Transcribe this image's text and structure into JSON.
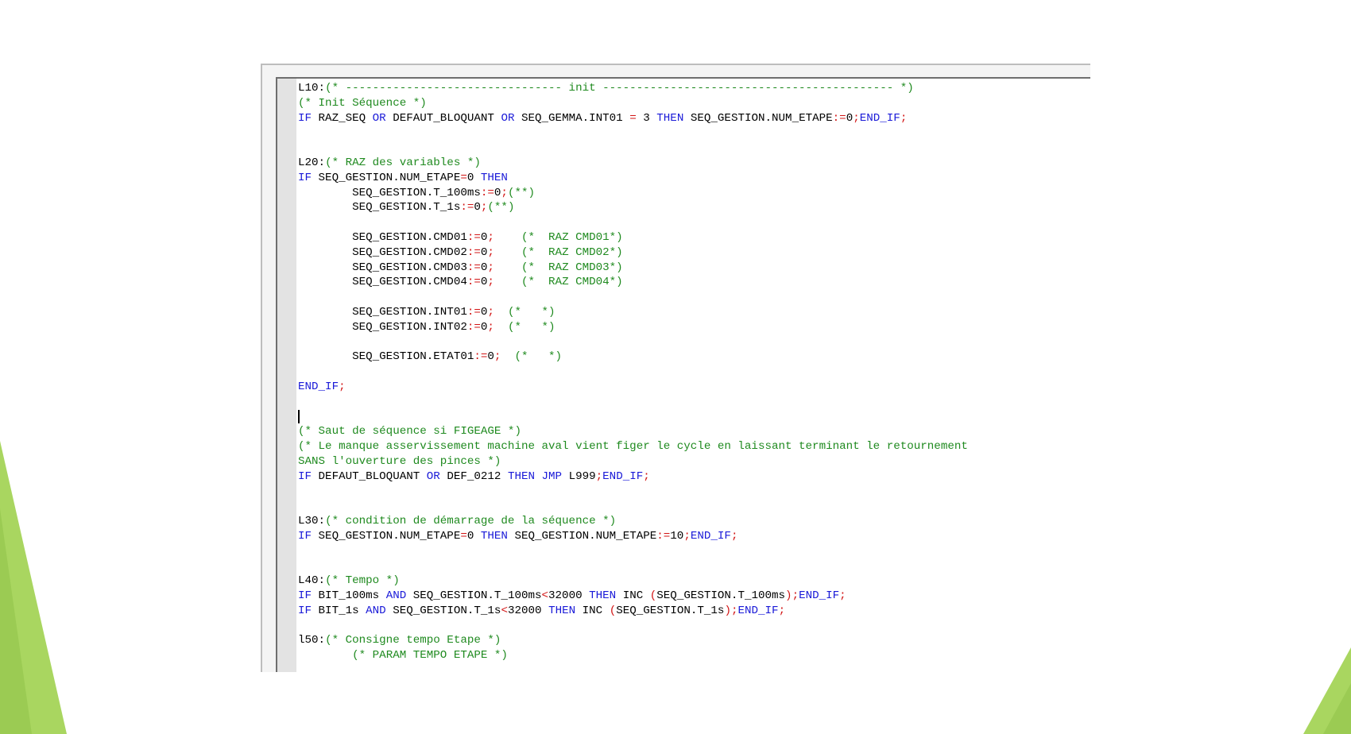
{
  "editor": {
    "lines": [
      [
        {
          "t": "L10:",
          "c": "id"
        },
        {
          "t": "(* -------------------------------- init ------------------------------------------- *)",
          "c": "cm"
        }
      ],
      [
        {
          "t": "(* Init Séquence *)",
          "c": "cm"
        }
      ],
      [
        {
          "t": "IF",
          "c": "kw"
        },
        {
          "t": " RAZ_SEQ ",
          "c": "id"
        },
        {
          "t": "OR",
          "c": "kw"
        },
        {
          "t": " DEFAUT_BLOQUANT ",
          "c": "id"
        },
        {
          "t": "OR",
          "c": "kw"
        },
        {
          "t": " SEQ_GEMMA.INT01 ",
          "c": "id"
        },
        {
          "t": "=",
          "c": "op"
        },
        {
          "t": " 3 ",
          "c": "id"
        },
        {
          "t": "THEN",
          "c": "kw"
        },
        {
          "t": " SEQ_GESTION.NUM_ETAPE",
          "c": "id"
        },
        {
          "t": ":=",
          "c": "op"
        },
        {
          "t": "0",
          "c": "id"
        },
        {
          "t": ";",
          "c": "op"
        },
        {
          "t": "END_IF",
          "c": "kw"
        },
        {
          "t": ";",
          "c": "op"
        }
      ],
      [],
      [],
      [
        {
          "t": "L20:",
          "c": "id"
        },
        {
          "t": "(* RAZ des variables *)",
          "c": "cm"
        }
      ],
      [
        {
          "t": "IF",
          "c": "kw"
        },
        {
          "t": " SEQ_GESTION.NUM_ETAPE",
          "c": "id"
        },
        {
          "t": "=",
          "c": "op"
        },
        {
          "t": "0 ",
          "c": "id"
        },
        {
          "t": "THEN",
          "c": "kw"
        }
      ],
      [
        {
          "t": "        SEQ_GESTION.T_100ms",
          "c": "id"
        },
        {
          "t": ":=",
          "c": "op"
        },
        {
          "t": "0",
          "c": "id"
        },
        {
          "t": ";",
          "c": "op"
        },
        {
          "t": "(**)",
          "c": "cm"
        }
      ],
      [
        {
          "t": "        SEQ_GESTION.T_1s",
          "c": "id"
        },
        {
          "t": ":=",
          "c": "op"
        },
        {
          "t": "0",
          "c": "id"
        },
        {
          "t": ";",
          "c": "op"
        },
        {
          "t": "(**)",
          "c": "cm"
        }
      ],
      [],
      [
        {
          "t": "        SEQ_GESTION.CMD01",
          "c": "id"
        },
        {
          "t": ":=",
          "c": "op"
        },
        {
          "t": "0",
          "c": "id"
        },
        {
          "t": ";",
          "c": "op"
        },
        {
          "t": "    ",
          "c": "id"
        },
        {
          "t": "(*  RAZ CMD01*)",
          "c": "cm"
        }
      ],
      [
        {
          "t": "        SEQ_GESTION.CMD02",
          "c": "id"
        },
        {
          "t": ":=",
          "c": "op"
        },
        {
          "t": "0",
          "c": "id"
        },
        {
          "t": ";",
          "c": "op"
        },
        {
          "t": "    ",
          "c": "id"
        },
        {
          "t": "(*  RAZ CMD02*)",
          "c": "cm"
        }
      ],
      [
        {
          "t": "        SEQ_GESTION.CMD03",
          "c": "id"
        },
        {
          "t": ":=",
          "c": "op"
        },
        {
          "t": "0",
          "c": "id"
        },
        {
          "t": ";",
          "c": "op"
        },
        {
          "t": "    ",
          "c": "id"
        },
        {
          "t": "(*  RAZ CMD03*)",
          "c": "cm"
        }
      ],
      [
        {
          "t": "        SEQ_GESTION.CMD04",
          "c": "id"
        },
        {
          "t": ":=",
          "c": "op"
        },
        {
          "t": "0",
          "c": "id"
        },
        {
          "t": ";",
          "c": "op"
        },
        {
          "t": "    ",
          "c": "id"
        },
        {
          "t": "(*  RAZ CMD04*)",
          "c": "cm"
        }
      ],
      [],
      [
        {
          "t": "        SEQ_GESTION.INT01",
          "c": "id"
        },
        {
          "t": ":=",
          "c": "op"
        },
        {
          "t": "0",
          "c": "id"
        },
        {
          "t": ";",
          "c": "op"
        },
        {
          "t": "  ",
          "c": "id"
        },
        {
          "t": "(*   *)",
          "c": "cm"
        }
      ],
      [
        {
          "t": "        SEQ_GESTION.INT02",
          "c": "id"
        },
        {
          "t": ":=",
          "c": "op"
        },
        {
          "t": "0",
          "c": "id"
        },
        {
          "t": ";",
          "c": "op"
        },
        {
          "t": "  ",
          "c": "id"
        },
        {
          "t": "(*   *)",
          "c": "cm"
        }
      ],
      [],
      [
        {
          "t": "        SEQ_GESTION.ETAT01",
          "c": "id"
        },
        {
          "t": ":=",
          "c": "op"
        },
        {
          "t": "0",
          "c": "id"
        },
        {
          "t": ";",
          "c": "op"
        },
        {
          "t": "  ",
          "c": "id"
        },
        {
          "t": "(*   *)",
          "c": "cm"
        }
      ],
      [],
      [
        {
          "t": "END_IF",
          "c": "kw"
        },
        {
          "t": ";",
          "c": "op"
        }
      ],
      [],
      [
        {
          "t": "",
          "c": "cursor"
        }
      ],
      [
        {
          "t": "(* Saut de séquence si FIGEAGE *)",
          "c": "cm"
        }
      ],
      [
        {
          "t": "(* Le manque asservissement machine aval vient figer le cycle en laissant terminant le retournement",
          "c": "cm"
        }
      ],
      [
        {
          "t": "SANS l'ouverture des pinces *)",
          "c": "cm"
        }
      ],
      [
        {
          "t": "IF",
          "c": "kw"
        },
        {
          "t": " DEFAUT_BLOQUANT ",
          "c": "id"
        },
        {
          "t": "OR",
          "c": "kw"
        },
        {
          "t": " DEF_0212 ",
          "c": "id"
        },
        {
          "t": "THEN",
          "c": "kw"
        },
        {
          "t": " ",
          "c": "id"
        },
        {
          "t": "JMP",
          "c": "kw"
        },
        {
          "t": " L999",
          "c": "id"
        },
        {
          "t": ";",
          "c": "op"
        },
        {
          "t": "END_IF",
          "c": "kw"
        },
        {
          "t": ";",
          "c": "op"
        }
      ],
      [],
      [],
      [
        {
          "t": "L30:",
          "c": "id"
        },
        {
          "t": "(* condition de démarrage de la séquence *)",
          "c": "cm"
        }
      ],
      [
        {
          "t": "IF",
          "c": "kw"
        },
        {
          "t": " SEQ_GESTION.NUM_ETAPE",
          "c": "id"
        },
        {
          "t": "=",
          "c": "op"
        },
        {
          "t": "0 ",
          "c": "id"
        },
        {
          "t": "THEN",
          "c": "kw"
        },
        {
          "t": " SEQ_GESTION.NUM_ETAPE",
          "c": "id"
        },
        {
          "t": ":=",
          "c": "op"
        },
        {
          "t": "10",
          "c": "id"
        },
        {
          "t": ";",
          "c": "op"
        },
        {
          "t": "END_IF",
          "c": "kw"
        },
        {
          "t": ";",
          "c": "op"
        }
      ],
      [],
      [],
      [
        {
          "t": "L40:",
          "c": "id"
        },
        {
          "t": "(* Tempo *)",
          "c": "cm"
        }
      ],
      [
        {
          "t": "IF",
          "c": "kw"
        },
        {
          "t": " BIT_100ms ",
          "c": "id"
        },
        {
          "t": "AND",
          "c": "kw"
        },
        {
          "t": " SEQ_GESTION.T_100ms",
          "c": "id"
        },
        {
          "t": "<",
          "c": "op"
        },
        {
          "t": "32000 ",
          "c": "id"
        },
        {
          "t": "THEN",
          "c": "kw"
        },
        {
          "t": " INC ",
          "c": "id"
        },
        {
          "t": "(",
          "c": "op"
        },
        {
          "t": "SEQ_GESTION.T_100ms",
          "c": "id"
        },
        {
          "t": ")",
          "c": "op"
        },
        {
          "t": ";",
          "c": "op"
        },
        {
          "t": "END_IF",
          "c": "kw"
        },
        {
          "t": ";",
          "c": "op"
        }
      ],
      [
        {
          "t": "IF",
          "c": "kw"
        },
        {
          "t": " BIT_1s ",
          "c": "id"
        },
        {
          "t": "AND",
          "c": "kw"
        },
        {
          "t": " SEQ_GESTION.T_1s",
          "c": "id"
        },
        {
          "t": "<",
          "c": "op"
        },
        {
          "t": "32000 ",
          "c": "id"
        },
        {
          "t": "THEN",
          "c": "kw"
        },
        {
          "t": " INC ",
          "c": "id"
        },
        {
          "t": "(",
          "c": "op"
        },
        {
          "t": "SEQ_GESTION.T_1s",
          "c": "id"
        },
        {
          "t": ")",
          "c": "op"
        },
        {
          "t": ";",
          "c": "op"
        },
        {
          "t": "END_IF",
          "c": "kw"
        },
        {
          "t": ";",
          "c": "op"
        }
      ],
      [],
      [
        {
          "t": "l50:",
          "c": "id"
        },
        {
          "t": "(* Consigne tempo Etape *)",
          "c": "cm"
        }
      ],
      [
        {
          "t": "        ",
          "c": "id"
        },
        {
          "t": "(* PARAM TEMPO ETAPE *)",
          "c": "cm"
        }
      ]
    ]
  },
  "colors": {
    "keyword": "#1a1ad8",
    "operator": "#d21414",
    "comment": "#1f8a1f",
    "identifier": "#000000",
    "accent_green_light": "#a9d660",
    "accent_green_dark": "#7fb636"
  }
}
